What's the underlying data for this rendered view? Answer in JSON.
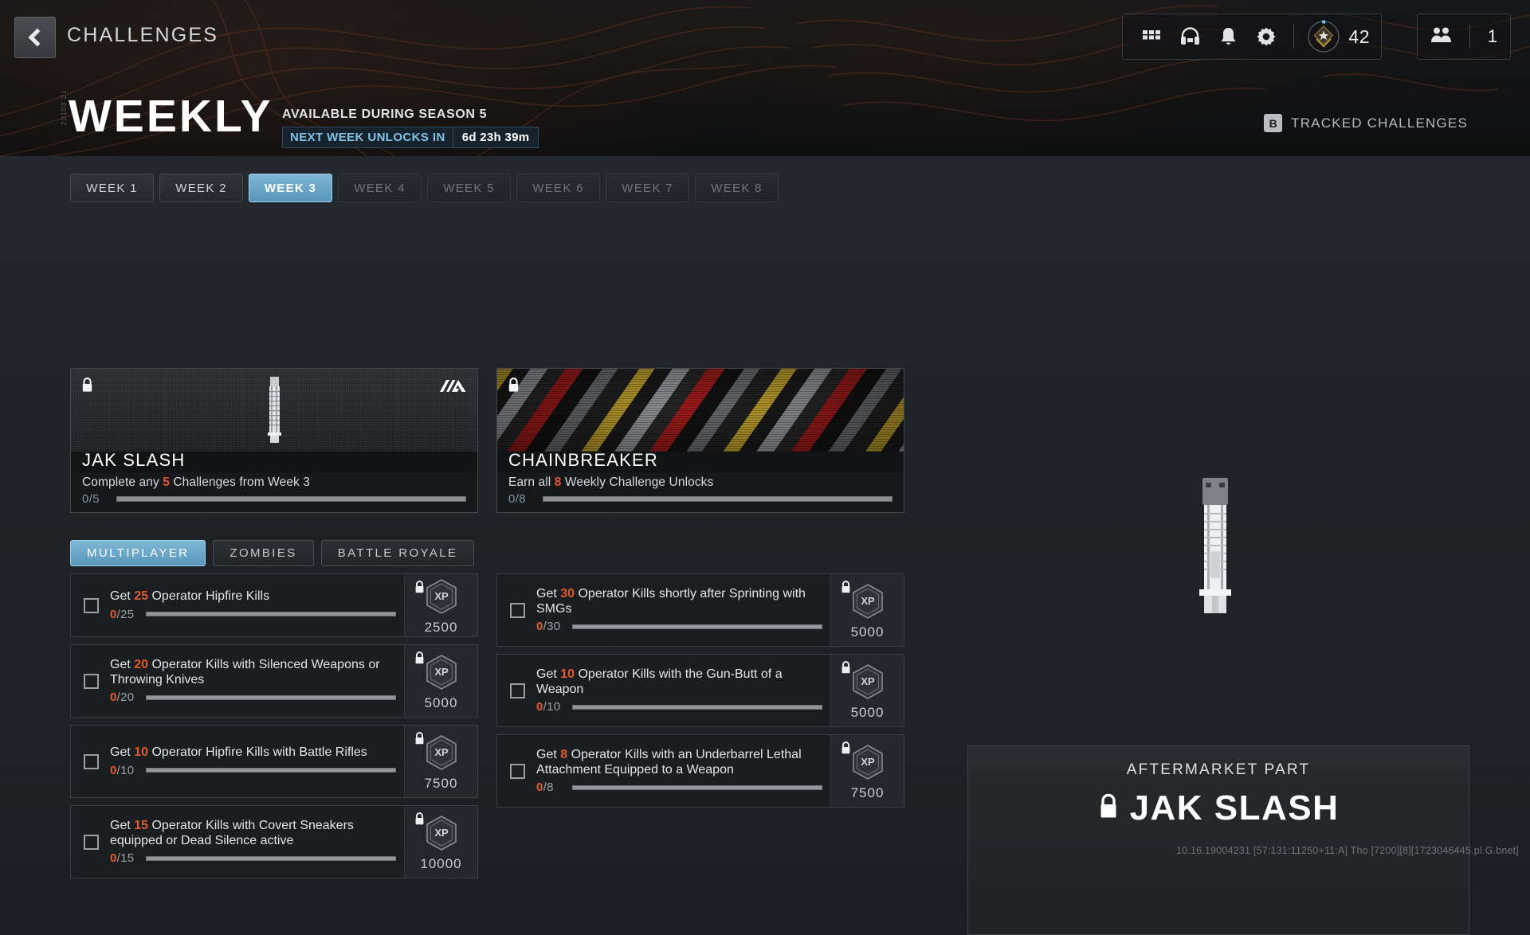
{
  "header": {
    "back_icon": "chevron-left-icon",
    "title": "CHALLENGES",
    "icons": [
      "grid-icon",
      "headset-icon",
      "bell-icon",
      "gear-icon"
    ],
    "rank_value": "42",
    "rank_icon": "rank-badge-icon",
    "squad_icon": "squad-icon",
    "squad_value": "1"
  },
  "hero": {
    "side_code": "20103 21",
    "title": "WEEKLY",
    "availability": "AVAILABLE DURING SEASON 5",
    "countdown_label": "NEXT WEEK UNLOCKS IN",
    "countdown_value": "6d 23h 39m",
    "tracked_key": "B",
    "tracked_label": "TRACKED CHALLENGES",
    "accent_blue": "#7fc4e8"
  },
  "week_tabs": [
    {
      "label": "WEEK 1",
      "state": "available"
    },
    {
      "label": "WEEK 2",
      "state": "available"
    },
    {
      "label": "WEEK 3",
      "state": "active"
    },
    {
      "label": "WEEK 4",
      "state": "locked"
    },
    {
      "label": "WEEK 5",
      "state": "locked"
    },
    {
      "label": "WEEK 6",
      "state": "locked"
    },
    {
      "label": "WEEK 7",
      "state": "locked"
    },
    {
      "label": "WEEK 8",
      "state": "locked"
    }
  ],
  "rewards": [
    {
      "name": "JAK SLASH",
      "description_prefix": "Complete any ",
      "description_number": "5",
      "description_suffix": " Challenges from Week 3",
      "progress": "0/5",
      "locked": true,
      "badge_icon": "aftermarket-part-icon"
    },
    {
      "name": "CHAINBREAKER",
      "description_prefix": "Earn all ",
      "description_number": "8",
      "description_suffix": " Weekly Challenge Unlocks",
      "progress": "0/8",
      "locked": true,
      "badge_icon": null
    }
  ],
  "mode_tabs": [
    {
      "label": "MULTIPLAYER",
      "state": "active"
    },
    {
      "label": "ZOMBIES",
      "state": "inactive"
    },
    {
      "label": "BATTLE ROYALE",
      "state": "inactive"
    }
  ],
  "challenges_left": [
    {
      "prefix": "Get ",
      "number": "25",
      "suffix": " Operator Hipfire Kills",
      "current": "0",
      "total": "/25",
      "xp": "2500",
      "xp_label": "XP",
      "locked": true,
      "lines": 1
    },
    {
      "prefix": "Get ",
      "number": "20",
      "suffix": " Operator Kills with Silenced Weapons or Throwing Knives",
      "current": "0",
      "total": "/20",
      "xp": "5000",
      "xp_label": "XP",
      "locked": true,
      "lines": 2
    },
    {
      "prefix": "Get ",
      "number": "10",
      "suffix": " Operator Hipfire Kills with Battle Rifles",
      "current": "0",
      "total": "/10",
      "xp": "7500",
      "xp_label": "XP",
      "locked": true,
      "lines": 2
    },
    {
      "prefix": "Get ",
      "number": "15",
      "suffix": " Operator Kills with Covert Sneakers equipped or Dead Silence active",
      "current": "0",
      "total": "/15",
      "xp": "10000",
      "xp_label": "XP",
      "locked": true,
      "lines": 2
    }
  ],
  "challenges_right": [
    {
      "prefix": "Get ",
      "number": "30",
      "suffix": " Operator Kills shortly after Sprinting with SMGs",
      "current": "0",
      "total": "/30",
      "xp": "5000",
      "xp_label": "XP",
      "locked": true,
      "lines": 2
    },
    {
      "prefix": "Get ",
      "number": "10",
      "suffix": " Operator Kills with the Gun-Butt of a Weapon",
      "current": "0",
      "total": "/10",
      "xp": "5000",
      "xp_label": "XP",
      "locked": true,
      "lines": 2
    },
    {
      "prefix": "Get ",
      "number": "8",
      "suffix": " Operator Kills with an Underbarrel Lethal Attachment Equipped to a Weapon",
      "current": "0",
      "total": "/8",
      "xp": "7500",
      "xp_label": "XP",
      "locked": true,
      "lines": 2
    }
  ],
  "preview": {
    "kicker": "AFTERMARKET PART",
    "title": "JAK SLASH",
    "locked": true
  },
  "debug_text": "10.16.19004231 [57:131:11250+11:A] Tho [7200][8][1723046445.pl.G.bnet]",
  "colors": {
    "accent_orange": "#e05a2b",
    "accent_blue": "#7fb8d6",
    "progress_blue": "#7e97a8"
  }
}
